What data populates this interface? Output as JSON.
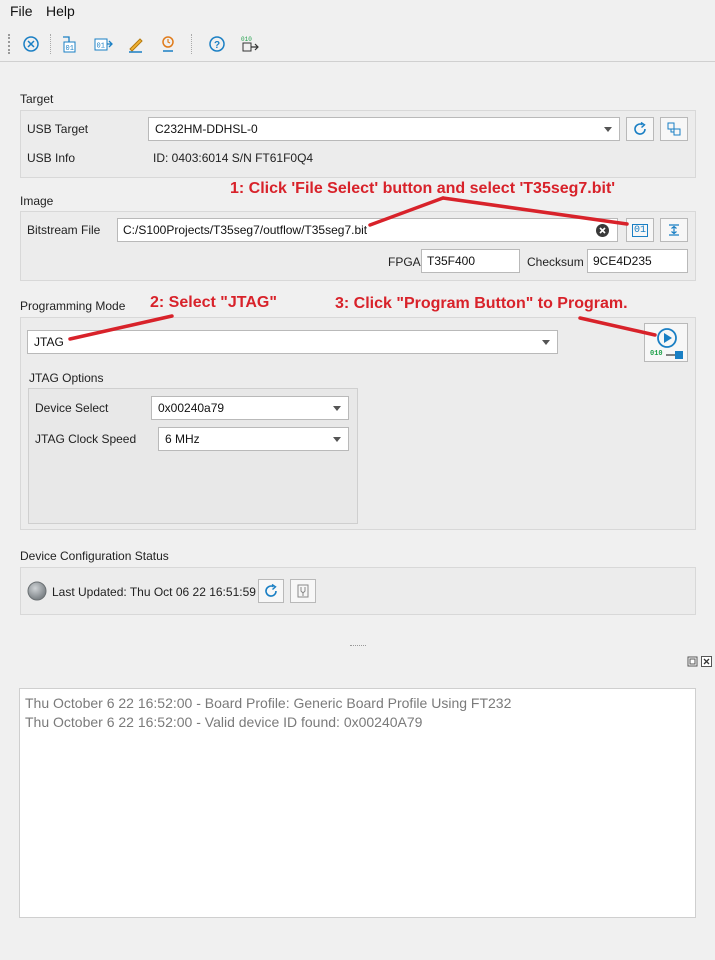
{
  "menu": {
    "file": "File",
    "help": "Help"
  },
  "toolbar": {
    "icons": [
      "cancel-icon",
      "import-icon",
      "export-binary-icon",
      "edit-icon",
      "profile-icon",
      "help-icon",
      "binary-download-icon"
    ]
  },
  "target": {
    "section": "Target",
    "usb_target_label": "USB Target",
    "usb_target_value": "C232HM-DDHSL-0",
    "usb_info_label": "USB Info",
    "usb_info_value": "ID: 0403:6014 S/N FT61F0Q4"
  },
  "image": {
    "section": "Image",
    "bitstream_label": "Bitstream File",
    "bitstream_value": "C:/S100Projects/T35seg7/outflow/T35seg7.bit",
    "fpga_label": "FPGA",
    "fpga_value": "T35F400",
    "checksum_label": "Checksum",
    "checksum_value": "9CE4D235",
    "file_select_glyph": "01"
  },
  "programming": {
    "section": "Programming Mode",
    "mode_value": "JTAG",
    "jtag_options_label": "JTAG Options",
    "device_select_label": "Device Select",
    "device_select_value": "0x00240a79",
    "clock_label": "JTAG Clock Speed",
    "clock_value": "6 MHz",
    "program_glyph": "010"
  },
  "status": {
    "section": "Device Configuration Status",
    "last_updated": "Last Updated: Thu Oct 06 22 16:51:59"
  },
  "annotations": {
    "step1": "1: Click 'File Select' button and select 'T35seg7.bit'",
    "step2": "2: Select \"JTAG\"",
    "step3": "3: Click \"Program Button\" to Program."
  },
  "log": {
    "lines": [
      "Thu October 6 22 16:52:00 - Board Profile: Generic Board Profile Using FT232",
      "Thu October 6 22 16:52:00 - Valid device ID found: 0x00240A79"
    ]
  },
  "colors": {
    "annotation": "#d8222a",
    "accent_blue": "#1a7fc4",
    "green": "#1fa04a"
  }
}
